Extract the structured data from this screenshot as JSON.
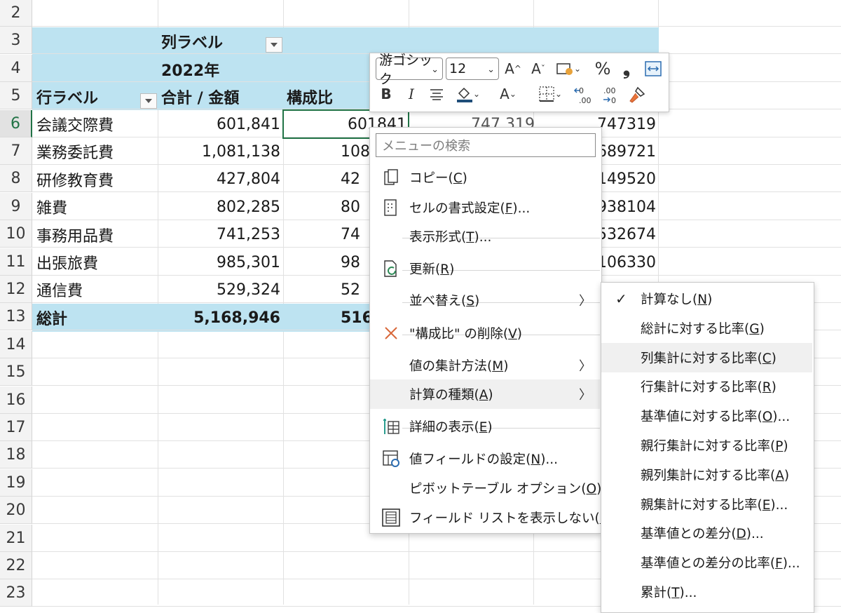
{
  "rows": [
    "2",
    "3",
    "4",
    "5",
    "6",
    "7",
    "8",
    "9",
    "10",
    "11",
    "12",
    "13",
    "14",
    "15",
    "16",
    "17",
    "18",
    "19",
    "20",
    "21",
    "22",
    "23"
  ],
  "pivot": {
    "column_labels": "列ラベル",
    "year": "2022年",
    "row_labels": "行ラベル",
    "sum_amount": "合計 / 金額",
    "ratio": "構成比",
    "items": [
      {
        "name": "会議交際費",
        "amount": "601,841",
        "ratio": "601841"
      },
      {
        "name": "業務委託費",
        "amount": "1,081,138",
        "ratio": "108"
      },
      {
        "name": "研修教育費",
        "amount": "427,804",
        "ratio": "42"
      },
      {
        "name": "雑費",
        "amount": "802,285",
        "ratio": "80"
      },
      {
        "name": "事務用品費",
        "amount": "741,253",
        "ratio": "74"
      },
      {
        "name": "出張旅費",
        "amount": "985,301",
        "ratio": "98"
      },
      {
        "name": "通信費",
        "amount": "529,324",
        "ratio": "52"
      }
    ],
    "total_label": "総計",
    "total_amount": "5,168,946",
    "total_ratio": "516",
    "right_col_e6": "747,319",
    "right_col": [
      "747319",
      "689721",
      "149520",
      "938104",
      "532674",
      "106330"
    ]
  },
  "mini_toolbar": {
    "font": "游ゴシック",
    "size": "12",
    "buttons": [
      "increase-font",
      "decrease-font",
      "number-format",
      "percent",
      "comma",
      "wrap",
      "bold",
      "italic",
      "center",
      "fill-color",
      "font-color",
      "borders",
      "decrease-decimal",
      "increase-decimal",
      "format-painter"
    ],
    "bold": "B",
    "italic": "I",
    "grow": "A",
    "shrink": "A",
    "percent": "%",
    "comma": "❟",
    "font_color": "A"
  },
  "menu": {
    "search_placeholder": "メニューの検索",
    "items": [
      {
        "label": "コピー(C)",
        "pre": "コピー(",
        "key": "C",
        "post": ")"
      },
      {
        "label": "セルの書式設定(F)...",
        "pre": "セルの書式設定(",
        "key": "F",
        "post": ")..."
      },
      {
        "label": "表示形式(T)...",
        "pre": "表示形式(",
        "key": "T",
        "post": ")..."
      },
      {
        "label": "更新(R)",
        "pre": "更新(",
        "key": "R",
        "post": ")"
      },
      {
        "label": "並べ替え(S)",
        "pre": "並べ替え(",
        "key": "S",
        "post": ")"
      },
      {
        "label": "\"構成比\" の削除(V)",
        "pre": "\"構成比\" の削除(",
        "key": "V",
        "post": ")"
      },
      {
        "label": "値の集計方法(M)",
        "pre": "値の集計方法(",
        "key": "M",
        "post": ")"
      },
      {
        "label": "計算の種類(A)",
        "pre": "計算の種類(",
        "key": "A",
        "post": ")"
      },
      {
        "label": "詳細の表示(E)",
        "pre": "詳細の表示(",
        "key": "E",
        "post": ")"
      },
      {
        "label": "値フィールドの設定(N)...",
        "pre": "値フィールドの設定(",
        "key": "N",
        "post": ")..."
      },
      {
        "label": "ピボットテーブル オプション(O)...",
        "pre": "ピボットテーブル オプション(",
        "key": "O",
        "post": ")..."
      },
      {
        "label": "フィールド リストを表示しない(D)",
        "pre": "フィールド リストを表示しない(",
        "key": "D",
        "post": ")"
      }
    ]
  },
  "submenu": {
    "items": [
      {
        "pre": "計算なし(",
        "key": "N",
        "post": ")",
        "checked": true
      },
      {
        "pre": "総計に対する比率(",
        "key": "G",
        "post": ")"
      },
      {
        "pre": "列集計に対する比率(",
        "key": "C",
        "post": ")"
      },
      {
        "pre": "行集計に対する比率(",
        "key": "R",
        "post": ")"
      },
      {
        "pre": "基準値に対する比率(",
        "key": "O",
        "post": ")..."
      },
      {
        "pre": "親行集計に対する比率(",
        "key": "P",
        "post": ")"
      },
      {
        "pre": "親列集計に対する比率(",
        "key": "A",
        "post": ")"
      },
      {
        "pre": "親集計に対する比率(",
        "key": "E",
        "post": ")..."
      },
      {
        "pre": "基準値との差分(",
        "key": "D",
        "post": ")..."
      },
      {
        "pre": "基準値との差分の比率(",
        "key": "F",
        "post": ")..."
      },
      {
        "pre": "累計(",
        "key": "T",
        "post": ")..."
      }
    ],
    "check": "✓"
  },
  "colors": {
    "pivot_band": "#bde3f1",
    "selection": "#217346",
    "delete_x": "#d9683a"
  }
}
